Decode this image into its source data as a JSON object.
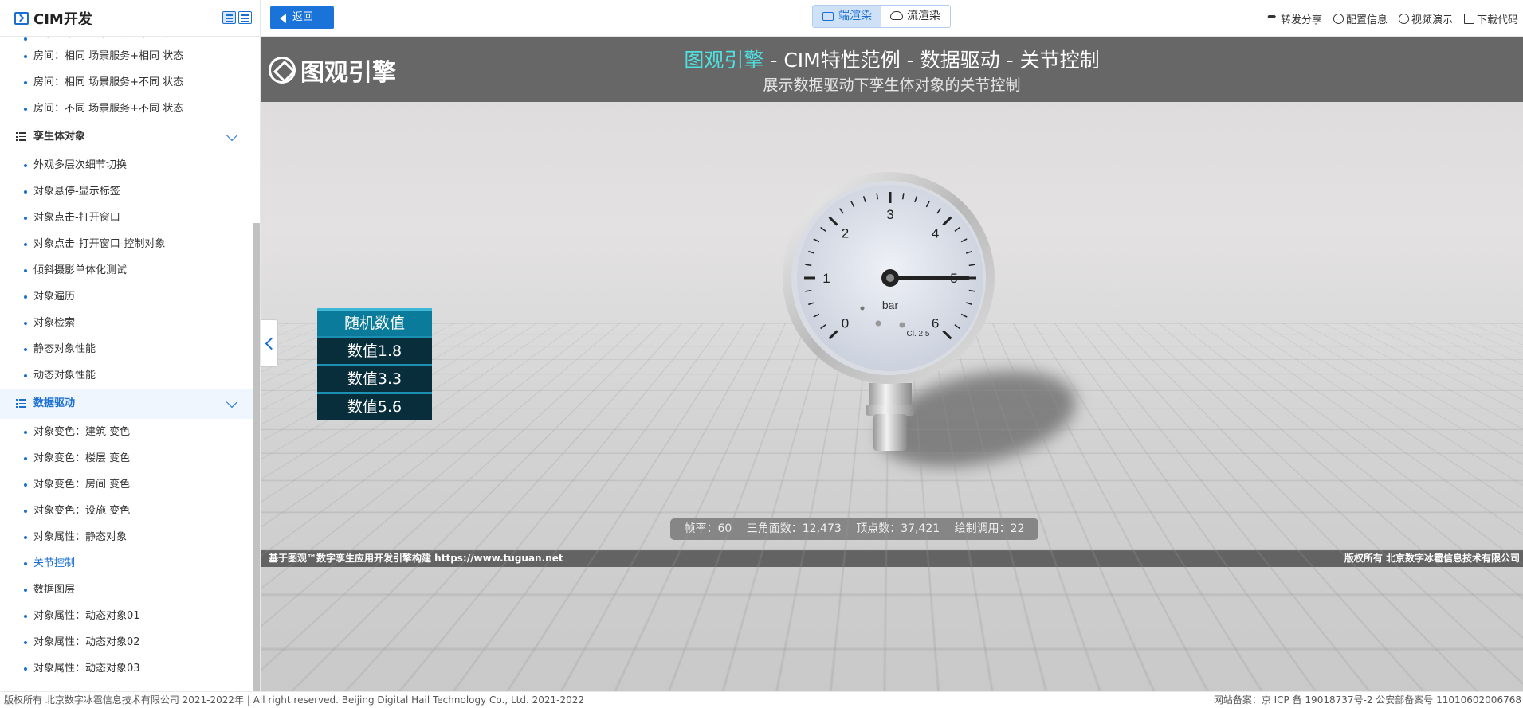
{
  "app": {
    "title": "CIM开发"
  },
  "sidebar": {
    "partial_item": "场景：不同 场景服务+不同 状态",
    "section1_items": [
      "房间：相同 场景服务+相同 状态",
      "房间：相同 场景服务+不同 状态",
      "房间：不同 场景服务+不同 状态"
    ],
    "group_twin": "孪生体对象",
    "twin_items": [
      "外观多层次细节切换",
      "对象悬停-显示标签",
      "对象点击-打开窗口",
      "对象点击-打开窗口-控制对象",
      "倾斜摄影单体化测试",
      "对象遍历",
      "对象检索",
      "静态对象性能",
      "动态对象性能"
    ],
    "group_data": "数据驱动",
    "data_items": [
      "对象变色：建筑 变色",
      "对象变色：楼层 变色",
      "对象变色：房间 变色",
      "对象变色：设施 变色",
      "对象属性：静态对象",
      "关节控制",
      "数据图层",
      "对象属性：动态对象01",
      "对象属性：动态对象02",
      "对象属性：动态对象03"
    ],
    "active_item": "关节控制"
  },
  "topbar": {
    "back_label": "返回",
    "render_tabs": [
      "端渲染",
      "流渲染"
    ],
    "active_render_tab": "端渲染",
    "links": [
      "转发分享",
      "配置信息",
      "视频演示",
      "下载代码"
    ]
  },
  "banner": {
    "brand": "图观引擎",
    "headline_highlight": "图观引擎",
    "headline_rest": " - CIM特性范例 - 数据驱动 - 关节控制",
    "subtitle": "展示数据驱动下孪生体对象的关节控制"
  },
  "controls": {
    "buttons": [
      "随机数值",
      "数值1.8",
      "数值3.3",
      "数值5.6"
    ]
  },
  "gauge": {
    "scale_labels": [
      "0",
      "1",
      "2",
      "3",
      "4",
      "5",
      "6"
    ],
    "unit": "bar",
    "class_label": "Cl. 2.5",
    "needle_value": 5.0,
    "scale_max": 6
  },
  "stats": {
    "fps_label": "帧率：",
    "fps": "60",
    "tri_label": "三角面数：",
    "tri": "12,473",
    "vert_label": "顶点数：",
    "vert": "37,421",
    "draw_label": "绘制调用：",
    "draw": "22"
  },
  "viewport_footer": {
    "left": "基于图观™数字孪生应用开发引擎构建 https://www.tuguan.net",
    "right": "版权所有 北京数字冰雹信息技术有限公司"
  },
  "page_footer": {
    "left": "版权所有 北京数字冰雹信息技术有限公司 2021-2022年 | All right reserved. Beijing Digital Hail Technology Co., Ltd. 2021-2022",
    "right": "网站备案：京 ICP 备 19018737号-2 公安部备案号 11010602006768"
  },
  "colors": {
    "accent": "#1a6fd1",
    "banner_highlight": "#4fe0e0",
    "button_dark": "#082d3b",
    "button_active": "#0a7b9a"
  }
}
